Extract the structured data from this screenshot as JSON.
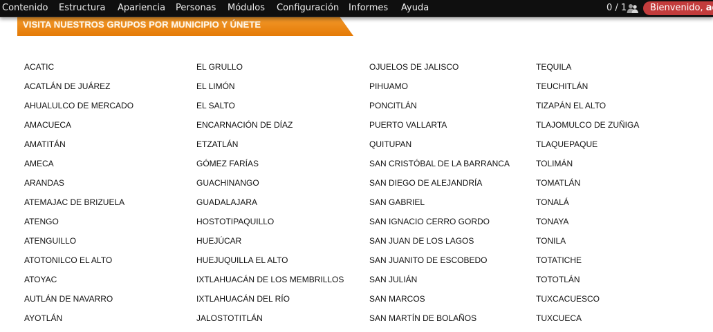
{
  "toolbar": {
    "menu": [
      "Contenido",
      "Estructura",
      "Apariencia",
      "Personas",
      "Módulos",
      "Configuración",
      "Informes",
      "Ayuda"
    ],
    "counter": "0 / 1",
    "users_icon": "users-icon",
    "welcome_prefix": "Bienvenido,",
    "welcome_user": "ad"
  },
  "banner": {
    "title": "VISITA NUESTROS GRUPOS POR MUNICIPIO Y ÚNETE",
    "color": "#f08c14"
  },
  "municipios": {
    "columns": [
      [
        "ACATIC",
        "ACATLÁN DE JUÁREZ",
        "AHUALULCO DE MERCADO",
        "AMACUECA",
        "AMATITÁN",
        "AMECA",
        "ARANDAS",
        "ATEMAJAC DE BRIZUELA",
        "ATENGO",
        "ATENGUILLO",
        "ATOTONILCO EL ALTO",
        "ATOYAC",
        "AUTLÁN DE NAVARRO",
        "AYOTLÁN"
      ],
      [
        "EL GRULLO",
        "EL LIMÓN",
        "EL SALTO",
        "ENCARNACIÓN DE DÍAZ",
        "ETZATLÁN",
        "GÓMEZ FARÍAS",
        "GUACHINANGO",
        "GUADALAJARA",
        "HOSTOTIPAQUILLO",
        "HUEJÚCAR",
        "HUEJUQUILLA EL ALTO",
        "IXTLAHUACÁN DE LOS MEMBRILLOS",
        "IXTLAHUACÁN DEL RÍO",
        "JALOSTOTITLÁN"
      ],
      [
        "OJUELOS DE JALISCO",
        "PIHUAMO",
        "PONCITLÁN",
        "PUERTO VALLARTA",
        "QUITUPAN",
        "SAN CRISTÓBAL DE LA BARRANCA",
        "SAN DIEGO DE ALEJANDRÍA",
        "SAN GABRIEL",
        "SAN IGNACIO CERRO GORDO",
        "SAN JUAN DE LOS LAGOS",
        "SAN JUANITO DE ESCOBEDO",
        "SAN JULIÁN",
        "SAN MARCOS",
        "SAN MARTÍN DE BOLAÑOS"
      ],
      [
        "TEQUILA",
        "TEUCHITLÁN",
        "TIZAPÁN EL ALTO",
        "TLAJOMULCO DE ZUÑIGA",
        "TLAQUEPAQUE",
        "TOLIMÁN",
        "TOMATLÁN",
        "TONALÁ",
        "TONAYA",
        "TONILA",
        "TOTATICHE",
        "TOTOTLÁN",
        "TUXCACUESCO",
        "TUXCUECA"
      ]
    ]
  }
}
